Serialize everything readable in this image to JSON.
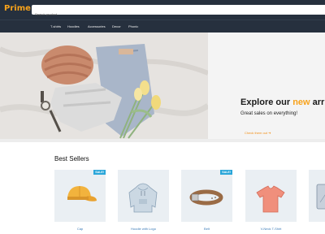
{
  "app": {
    "logo": "Prime"
  },
  "search": {
    "placeholder": "Search product..."
  },
  "nav": {
    "items": [
      "T-shirts",
      "Hoodies",
      "Accessories",
      "Decor",
      "Phonic"
    ]
  },
  "hero": {
    "title_prefix": "Explore our ",
    "title_accent": "new",
    "title_suffix": " arri",
    "subtitle": "Great sales on everything!",
    "cta": "Check them out",
    "cta_arrow": "➔"
  },
  "best_sellers": {
    "title": "Best Sellers",
    "products": [
      {
        "name": "Cap",
        "badge": "SALE!",
        "icon": "cap-icon"
      },
      {
        "name": "Hoodie with Logo",
        "badge": "",
        "icon": "hoodie-icon"
      },
      {
        "name": "Belt",
        "badge": "SALE!",
        "icon": "belt-icon"
      },
      {
        "name": "V-Neck T-Shirt",
        "badge": "",
        "icon": "tshirt-icon"
      }
    ]
  },
  "colors": {
    "header": "#26303e",
    "accent": "#f7a21b",
    "badge": "#2aa6d9",
    "link": "#3b7bb8",
    "card_bg": "#eaeff3"
  }
}
